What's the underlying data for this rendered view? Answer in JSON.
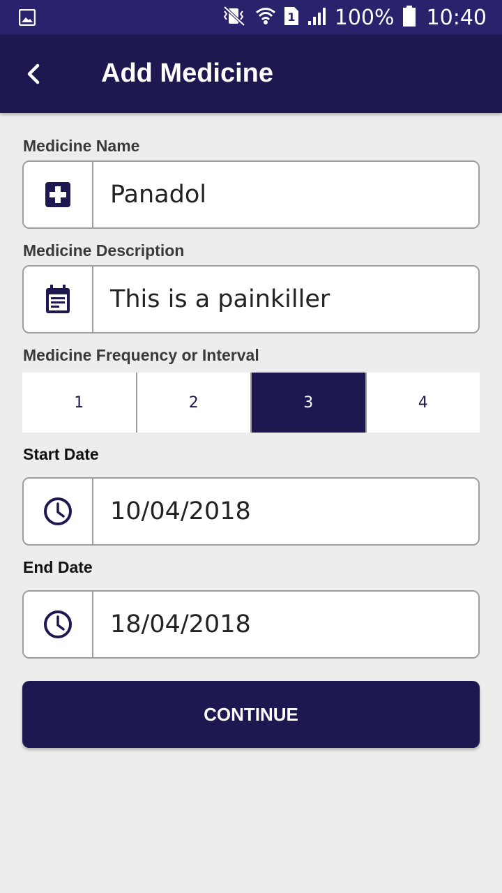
{
  "status_bar": {
    "battery_percent": "100%",
    "time": "10:40",
    "icons": [
      "gallery-icon",
      "vibrate-icon",
      "wifi-icon",
      "sim-icon",
      "signal-icon",
      "battery-icon"
    ]
  },
  "app_bar": {
    "title": "Add Medicine",
    "back_icon": "chevron-left-icon"
  },
  "form": {
    "name": {
      "label": "Medicine Name",
      "value": "Panadol",
      "icon": "medical-plus-icon"
    },
    "description": {
      "label": "Medicine Description",
      "value": "This is a painkiller",
      "icon": "note-icon"
    },
    "frequency": {
      "label": "Medicine Frequency or Interval",
      "options": [
        "1",
        "2",
        "3",
        "4"
      ],
      "selected": "3"
    },
    "start_date": {
      "label": "Start Date",
      "value": "10/04/2018",
      "icon": "clock-icon"
    },
    "end_date": {
      "label": "End Date",
      "value": "18/04/2018",
      "icon": "clock-icon"
    }
  },
  "continue_label": "CONTINUE",
  "colors": {
    "status_bar": "#29226d",
    "primary": "#1e1851",
    "background": "#ededed",
    "field_border": "#9e9e9e"
  }
}
